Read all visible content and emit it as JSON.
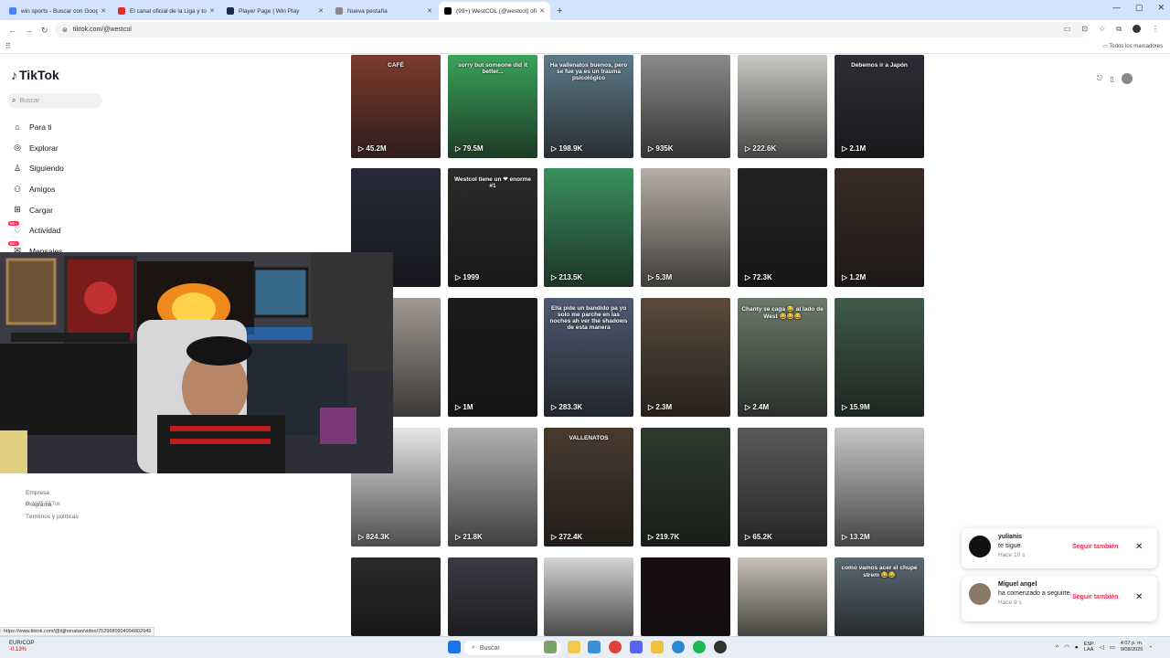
{
  "browser": {
    "tabs": [
      {
        "title": "win sports - Buscar con Google",
        "color": "#4285f4"
      },
      {
        "title": "El canal oficial de la Liga y todo",
        "color": "#e52d27"
      },
      {
        "title": "Player Page | Win Play",
        "color": "#1a2b4c"
      },
      {
        "title": "Nueva pestaña",
        "color": "#888888"
      },
      {
        "title": "(99+) WestCOL (@westcol) oficial",
        "color": "#000000",
        "active": true
      }
    ],
    "new_tab_glyph": "+",
    "url": "tiktok.com/@westcol",
    "bookmarks_label": "Todos los marcadores",
    "status_url": "https://www.tiktok.com/@djjhonatan/video/7529680904994802949"
  },
  "sidebar": {
    "logo": "TikTok",
    "search_placeholder": "Buscar",
    "items": [
      {
        "label": "Para ti",
        "icon": "home-icon",
        "glyph": "⌂"
      },
      {
        "label": "Explorar",
        "icon": "compass-icon",
        "glyph": "◎"
      },
      {
        "label": "Siguiendo",
        "icon": "following-icon",
        "glyph": "♙"
      },
      {
        "label": "Amigos",
        "icon": "friends-icon",
        "glyph": "⚇"
      },
      {
        "label": "Cargar",
        "icon": "upload-icon",
        "glyph": "⊞"
      },
      {
        "label": "Actividad",
        "icon": "activity-icon",
        "glyph": "♡",
        "badge": "99+"
      },
      {
        "label": "Mensajes",
        "icon": "messages-icon",
        "glyph": "✉",
        "badge": "99+"
      }
    ],
    "footer": [
      "Empresa",
      "Programa",
      "Términos y políticas"
    ],
    "copyright": "© 2025 TikTok"
  },
  "videos": [
    {
      "views": "45.2M",
      "caption": "CAFÉ",
      "bg": "#7a3b2e"
    },
    {
      "views": "79.5M",
      "caption": "sorry but someone did it better...",
      "bg": "#3aa35a"
    },
    {
      "views": "198.9K",
      "caption": "Ha vallenatos buenos, pero se fue ya es un trauma psicológico",
      "bg": "#5e7a8a"
    },
    {
      "views": "935K",
      "caption": "",
      "bg": "#8a8a88"
    },
    {
      "views": "222.6K",
      "caption": "",
      "bg": "#c9c9c4"
    },
    {
      "views": "2.1M",
      "caption": "Debemos ir a Japón",
      "bg": "#2d2d35"
    },
    {
      "views": "",
      "caption": "",
      "bg": "#27293a"
    },
    {
      "views": "1999",
      "caption": "Westcol tiene un ❤ enorme #1",
      "bg": "#2b2b2b"
    },
    {
      "views": "213.5K",
      "caption": "",
      "bg": "#3a8f5d"
    },
    {
      "views": "5.3M",
      "caption": "",
      "bg": "#b5aea4"
    },
    {
      "views": "72.3K",
      "caption": "",
      "bg": "#232323"
    },
    {
      "views": "1.2M",
      "caption": "",
      "bg": "#3a2b26"
    },
    {
      "views": "",
      "caption": "",
      "bg": "#a19a92"
    },
    {
      "views": "1M",
      "caption": "",
      "bg": "#1b1b1b"
    },
    {
      "views": "283.3K",
      "caption": "Ella pide un bandido pa yo solo me parche en las noches ah ver the shadows de esta manera",
      "bg": "#4e5a73"
    },
    {
      "views": "2.3M",
      "caption": "",
      "bg": "#5a4a3a"
    },
    {
      "views": "2.4M",
      "caption": "Chanty se caga 😂 al lado de West 😂😂😂",
      "bg": "#6a7a6a"
    },
    {
      "views": "15.9M",
      "caption": "",
      "bg": "#3f5a4a"
    },
    {
      "views": "824.3K",
      "caption": "",
      "bg": "#e6e6e6"
    },
    {
      "views": "21.8K",
      "caption": "",
      "bg": "#b2b2b2"
    },
    {
      "views": "272.4K",
      "caption": "VALLENATOS",
      "bg": "#4a3a2e"
    },
    {
      "views": "219.7K",
      "caption": "",
      "bg": "#2e3a2e"
    },
    {
      "views": "65.2K",
      "caption": "",
      "bg": "#5a5a5a"
    },
    {
      "views": "13.2M",
      "caption": "",
      "bg": "#c7c7c9"
    },
    {
      "views": "",
      "caption": "",
      "bg": "#2a2a2a"
    },
    {
      "views": "",
      "caption": "",
      "bg": "#3a3a44"
    },
    {
      "views": "",
      "caption": "",
      "bg": "#d4d4d2"
    },
    {
      "views": "",
      "caption": "",
      "bg": "#1a0c12"
    },
    {
      "views": "",
      "caption": "",
      "bg": "#c8c3b5"
    },
    {
      "views": "",
      "caption": "como vamos acer el chupe strem 😂😂",
      "bg": "#5a6a73"
    }
  ],
  "notifications": [
    {
      "name": "yulianis",
      "line": "te sigue.",
      "time": "Hace 10 s",
      "action": "Seguir también",
      "close": "✕",
      "avatar_color": "#111111"
    },
    {
      "name": "Miguel angel",
      "line": "ha comenzado a seguirte.",
      "time": "Hace 9 s",
      "action": "Seguir también",
      "close": "✕",
      "avatar_color": "#8a7a6a"
    }
  ],
  "taskbar": {
    "ticker": "EUR/COP",
    "change": "-0.13%",
    "search_placeholder": "Buscar",
    "lang": "ESP",
    "lang_sub": "LAA",
    "time": "4:07 p. m.",
    "date": "9/08/2025"
  }
}
